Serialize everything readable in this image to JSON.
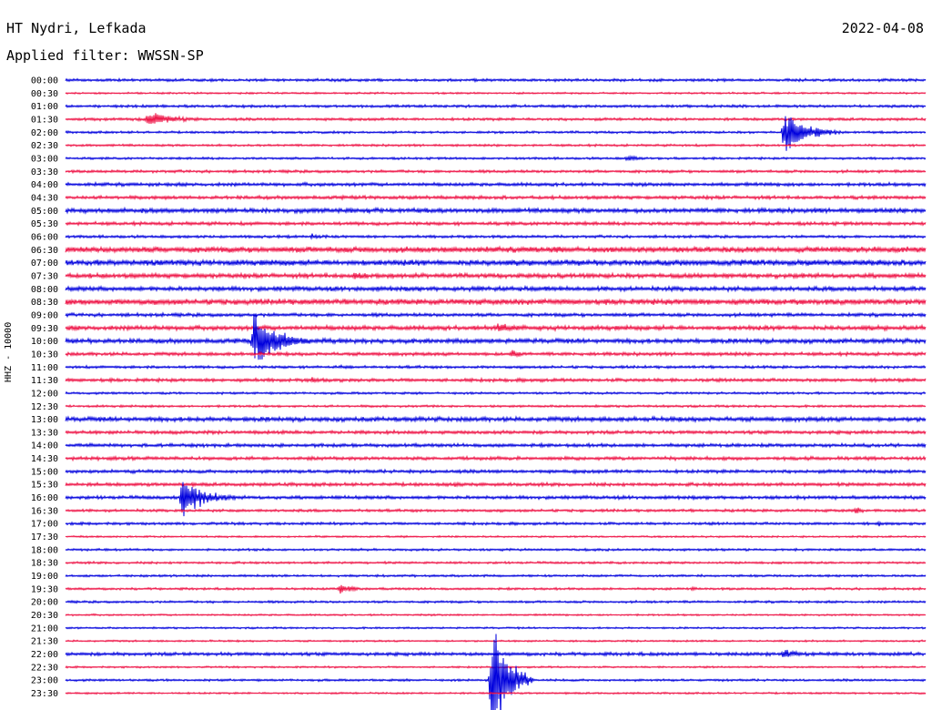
{
  "header": {
    "station": "HT Nydri, Lefkada",
    "date": "2022-04-08",
    "filter": "Applied filter: WWSSN-SP",
    "channel": "HHZ - 10000"
  },
  "colors": {
    "even_trace": "#0000dd",
    "odd_trace": "#ee1144",
    "background": "#ffffff",
    "text": "#000000"
  },
  "chart_data": {
    "type": "line",
    "title": "HT Nydri, Lefkada",
    "subtitle": "Applied filter: WWSSN-SP",
    "ylabel": "HHZ - 10000",
    "xlabel": "",
    "row_interval_minutes": 30,
    "rows": [
      "00:00",
      "00:30",
      "01:00",
      "01:30",
      "02:00",
      "02:30",
      "03:00",
      "03:30",
      "04:00",
      "04:30",
      "05:00",
      "05:30",
      "06:00",
      "06:30",
      "07:00",
      "07:30",
      "08:00",
      "08:30",
      "09:00",
      "09:30",
      "10:00",
      "10:30",
      "11:00",
      "11:30",
      "12:00",
      "12:30",
      "13:00",
      "13:30",
      "14:00",
      "14:30",
      "15:00",
      "15:30",
      "16:00",
      "16:30",
      "17:00",
      "17:30",
      "18:00",
      "18:30",
      "19:00",
      "19:30",
      "20:00",
      "20:30",
      "21:00",
      "21:30",
      "22:00",
      "22:30",
      "23:00",
      "23:30"
    ],
    "noise_level": [
      1.2,
      0.8,
      1.2,
      1.2,
      1.0,
      1.0,
      1.0,
      1.2,
      1.5,
      1.5,
      2.0,
      1.5,
      1.2,
      2.5,
      2.5,
      2.0,
      2.0,
      2.5,
      1.5,
      2.0,
      2.0,
      1.5,
      1.2,
      1.5,
      1.0,
      1.0,
      2.0,
      1.5,
      1.5,
      1.5,
      1.5,
      1.5,
      1.5,
      1.2,
      1.2,
      0.8,
      1.0,
      1.0,
      1.0,
      1.0,
      1.0,
      0.8,
      0.8,
      0.8,
      1.5,
      0.8,
      1.0,
      0.8
    ],
    "events": [
      {
        "row": 3,
        "minute": 2.8,
        "amplitude": 12,
        "duration_minutes": 2.5
      },
      {
        "row": 4,
        "minute": 25.0,
        "amplitude": 30,
        "duration_minutes": 2.2
      },
      {
        "row": 6,
        "minute": 19.5,
        "amplitude": 4,
        "duration_minutes": 2.0
      },
      {
        "row": 9,
        "minute": 3.3,
        "amplitude": 3,
        "duration_minutes": 1.5
      },
      {
        "row": 12,
        "minute": 8.5,
        "amplitude": 5,
        "duration_minutes": 1.0
      },
      {
        "row": 13,
        "minute": 16.2,
        "amplitude": 6,
        "duration_minutes": 1.0
      },
      {
        "row": 13,
        "minute": 12.5,
        "amplitude": 3,
        "duration_minutes": 2.0
      },
      {
        "row": 15,
        "minute": 10.0,
        "amplitude": 8,
        "duration_minutes": 1.5
      },
      {
        "row": 16,
        "minute": 14.0,
        "amplitude": 3,
        "duration_minutes": 4.0
      },
      {
        "row": 19,
        "minute": 15.0,
        "amplitude": 9,
        "duration_minutes": 1.5
      },
      {
        "row": 20,
        "minute": 6.5,
        "amplitude": 45,
        "duration_minutes": 2.2
      },
      {
        "row": 21,
        "minute": 15.5,
        "amplitude": 8,
        "duration_minutes": 1.0
      },
      {
        "row": 22,
        "minute": 9.5,
        "amplitude": 3,
        "duration_minutes": 1.5
      },
      {
        "row": 23,
        "minute": 8.5,
        "amplitude": 5,
        "duration_minutes": 1.5
      },
      {
        "row": 25,
        "minute": 3.0,
        "amplitude": 5,
        "duration_minutes": 0.3
      },
      {
        "row": 31,
        "minute": 13.5,
        "amplitude": 5,
        "duration_minutes": 1.0
      },
      {
        "row": 32,
        "minute": 4.0,
        "amplitude": 28,
        "duration_minutes": 2.2
      },
      {
        "row": 33,
        "minute": 27.5,
        "amplitude": 9,
        "duration_minutes": 0.6
      },
      {
        "row": 34,
        "minute": 28.3,
        "amplitude": 6,
        "duration_minutes": 0.5
      },
      {
        "row": 39,
        "minute": 9.5,
        "amplitude": 8,
        "duration_minutes": 1.5
      },
      {
        "row": 39,
        "minute": 21.8,
        "amplitude": 6,
        "duration_minutes": 0.4
      },
      {
        "row": 44,
        "minute": 15.5,
        "amplitude": 5,
        "duration_minutes": 0.3
      },
      {
        "row": 44,
        "minute": 25.0,
        "amplitude": 9,
        "duration_minutes": 1.2
      },
      {
        "row": 46,
        "minute": 14.8,
        "amplitude": 100,
        "duration_minutes": 1.5
      }
    ],
    "ylim": [
      0,
      48
    ],
    "grid": false,
    "legend": "none"
  }
}
